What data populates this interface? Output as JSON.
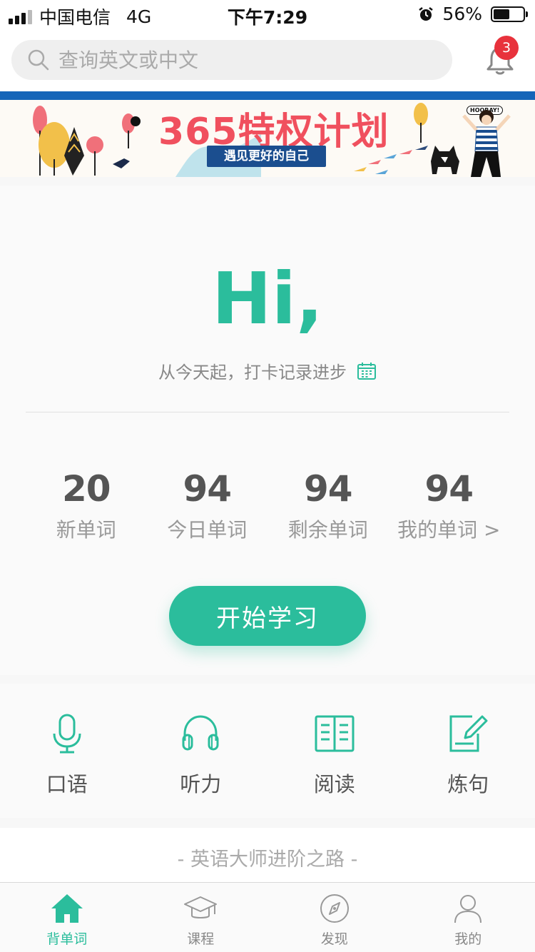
{
  "status_bar": {
    "carrier": "中国电信",
    "network": "4G",
    "time": "下午7:29",
    "battery_percent": "56%",
    "battery_level": 0.56
  },
  "header": {
    "search_placeholder": "查询英文或中文",
    "notification_count": "3"
  },
  "banner": {
    "title": "365特权计划",
    "subtitle": "遇见更好的自己",
    "sticker": "HOORAY!"
  },
  "greeting": {
    "title": "Hi,",
    "tagline": "从今天起，打卡记录进步"
  },
  "stats": [
    {
      "value": "20",
      "label": "新单词"
    },
    {
      "value": "94",
      "label": "今日单词"
    },
    {
      "value": "94",
      "label": "剩余单词"
    },
    {
      "value": "94",
      "label": "我的单词 >"
    }
  ],
  "start_button": "开始学习",
  "features": [
    {
      "label": "口语",
      "icon": "microphone-icon"
    },
    {
      "label": "听力",
      "icon": "headphones-icon"
    },
    {
      "label": "阅读",
      "icon": "book-icon"
    },
    {
      "label": "炼句",
      "icon": "edit-note-icon"
    }
  ],
  "section_tagline": "- 英语大师进阶之路 -",
  "tabbar": [
    {
      "label": "背单词",
      "icon": "home-icon",
      "active": true
    },
    {
      "label": "课程",
      "icon": "graduation-cap-icon",
      "active": false
    },
    {
      "label": "发现",
      "icon": "compass-icon",
      "active": false
    },
    {
      "label": "我的",
      "icon": "user-icon",
      "active": false
    }
  ],
  "colors": {
    "accent": "#2bbd9c",
    "badge": "#e8323c",
    "banner_title": "#f0505e",
    "banner_strip": "#1565b8"
  }
}
